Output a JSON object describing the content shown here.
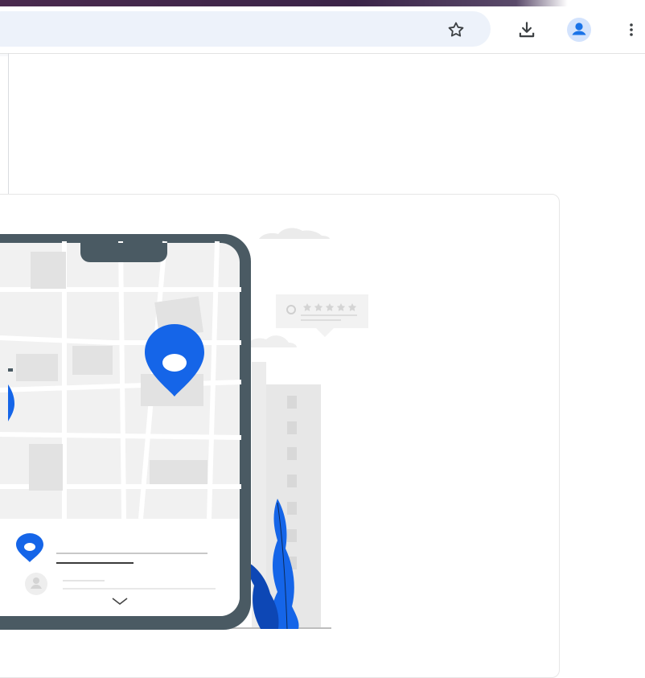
{
  "browser": {
    "toolbar": {
      "bookmark": {
        "icon": "star-outline-icon"
      },
      "download": {
        "icon": "download-icon"
      },
      "profile": {
        "icon": "account-icon",
        "accent": "#1a73e8"
      },
      "menu": {
        "icon": "more-vert-icon"
      }
    },
    "omnibox": {
      "value": ""
    }
  },
  "illustration": {
    "subject": "phone-map-location",
    "accent": "#1565e8",
    "frame": "#4a5a63",
    "map_bg": "#f1f1f1"
  }
}
